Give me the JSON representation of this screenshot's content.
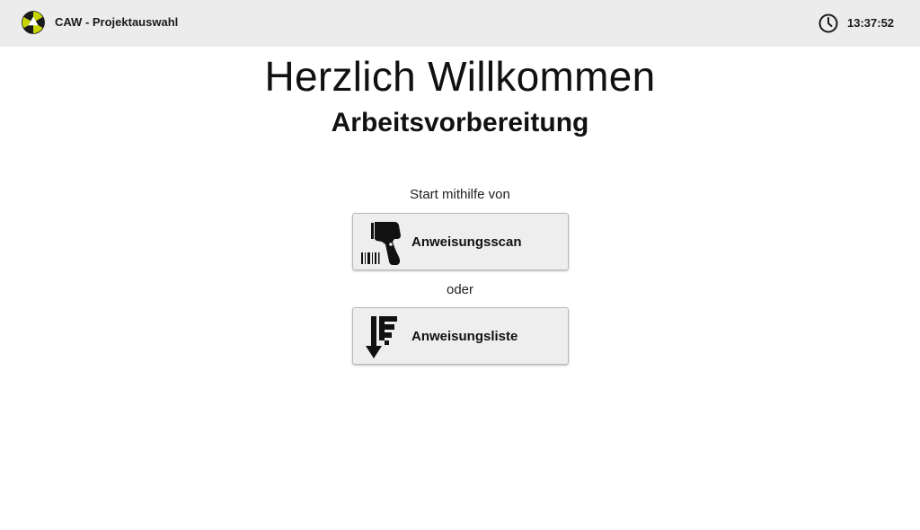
{
  "header": {
    "app_title": "CAW - Projektauswahl",
    "logo_icon": "caw-logo-icon",
    "clock_icon": "clock-icon",
    "time": "13:37:52",
    "logo_colors": [
      "#c8d400",
      "#1a1a1a",
      "#ffffff"
    ]
  },
  "main": {
    "welcome_title": "Herzlich Willkommen",
    "subtitle": "Arbeitsvorbereitung",
    "start_label": "Start mithilfe von",
    "or_label": "oder",
    "buttons": {
      "scan": {
        "label": "Anweisungsscan",
        "icon": "barcode-scanner-icon"
      },
      "list": {
        "label": "Anweisungsliste",
        "icon": "sort-list-down-icon"
      }
    }
  },
  "colors": {
    "topbar_bg": "#ececec",
    "button_bg": "#eeeeee",
    "text": "#111111"
  }
}
